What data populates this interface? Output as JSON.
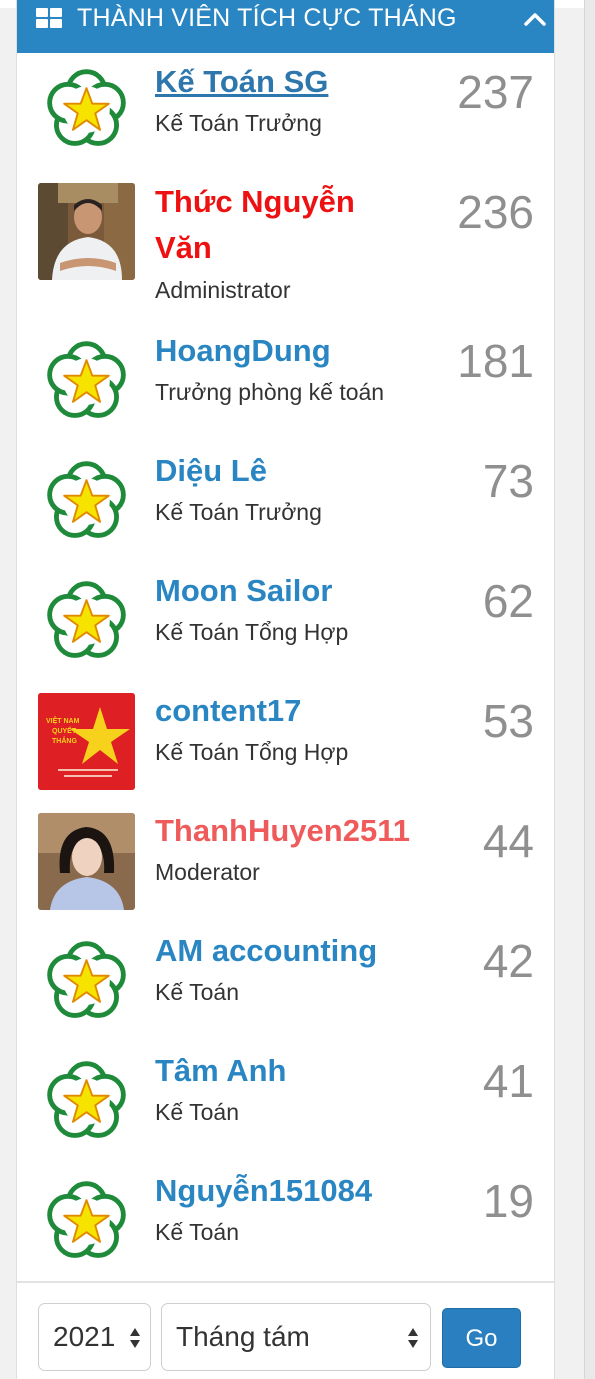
{
  "header": {
    "title": "THÀNH VIÊN TÍCH CỰC THÁNG",
    "grid_icon": "grid-icon",
    "toggle_icon": "chevron-up-icon"
  },
  "members": [
    {
      "name": "Kế Toán SG",
      "role": "Kế Toán Trưởng",
      "count": "237",
      "avatar": "default-star-avatar"
    },
    {
      "name": "Thức Nguyễn Văn",
      "role": "Administrator",
      "count": "236",
      "avatar": "photo-avatar"
    },
    {
      "name": "HoangDung",
      "role": "Trưởng phòng kế toán",
      "count": "181",
      "avatar": "default-star-avatar"
    },
    {
      "name": "Diệu Lê",
      "role": "Kế Toán Trưởng",
      "count": "73",
      "avatar": "default-star-avatar"
    },
    {
      "name": "Moon Sailor",
      "role": "Kế Toán Tổng Hợp",
      "count": "62",
      "avatar": "default-star-avatar"
    },
    {
      "name": "content17",
      "role": "Kế Toán Tổng Hợp",
      "count": "53",
      "avatar": "flag-avatar"
    },
    {
      "name": "ThanhHuyen2511",
      "role": "Moderator",
      "count": "44",
      "avatar": "photo-avatar"
    },
    {
      "name": "AM accounting",
      "role": "Kế Toán",
      "count": "42",
      "avatar": "default-star-avatar"
    },
    {
      "name": "Tâm Anh",
      "role": "Kế Toán",
      "count": "41",
      "avatar": "default-star-avatar"
    },
    {
      "name": "Nguyễn151084",
      "role": "Kế Toán",
      "count": "19",
      "avatar": "default-star-avatar"
    }
  ],
  "filter": {
    "year": "2021",
    "month": "Tháng tám",
    "go_label": "Go"
  },
  "colors": {
    "header_bg": "#2a86c2",
    "link": "#2a86c2",
    "admin": "#ee1111",
    "moderator": "#ef5b5b",
    "count": "#8f8f8f"
  }
}
